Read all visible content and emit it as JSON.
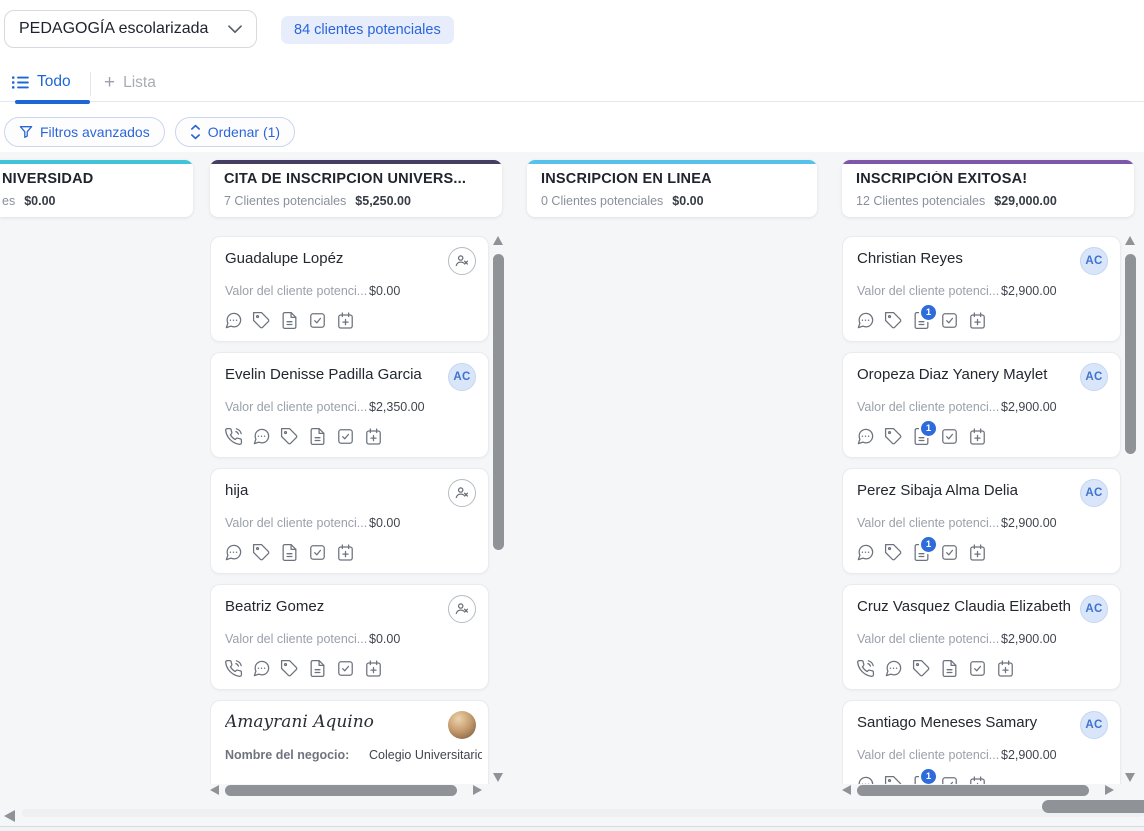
{
  "header": {
    "pipeline_selector": "PEDAGOGÍA escolarizada",
    "leads_count_badge": "84 clientes potenciales",
    "tabs": {
      "todo": "Todo",
      "lista_prefix": "+",
      "lista": "Lista"
    },
    "filters_button": "Filtros avanzados",
    "sort_button": "Ordenar (1)"
  },
  "colors": {
    "primary_blue": "#2b66d9",
    "notification_badge_blue": "#2e6bdb",
    "board_background": "#f5f6f7"
  },
  "board": {
    "columns": [
      {
        "title": "NIVERSIDAD",
        "count_text": "es",
        "value": "$0.00",
        "accent": "#41c4d5",
        "cards": []
      },
      {
        "title": "CITA DE INSCRIPCION UNIVERS...",
        "count_text": "7 Clientes potenciales",
        "value": "$5,250.00",
        "accent": "#454063",
        "cards": [
          {
            "name": "Guadalupe Lopéz",
            "field_label": "Valor del cliente potenci...",
            "field_value": "$0.00",
            "avatar": "unassigned",
            "icons": [
              "chat",
              "tag",
              "document",
              "task",
              "calendar"
            ]
          },
          {
            "name": "Evelin Denisse Padilla Garcia",
            "field_label": "Valor del cliente potenci...",
            "field_value": "$2,350.00",
            "avatar": "initials",
            "avatar_text": "AC",
            "icons": [
              "phone",
              "chat",
              "tag",
              "document",
              "task",
              "calendar"
            ]
          },
          {
            "name": "hija",
            "field_label": "Valor del cliente potenci...",
            "field_value": "$0.00",
            "avatar": "unassigned",
            "icons": [
              "chat",
              "tag",
              "document",
              "task",
              "calendar"
            ]
          },
          {
            "name": "Beatriz Gomez",
            "field_label": "Valor del cliente potenci...",
            "field_value": "$0.00",
            "avatar": "unassigned",
            "icons": [
              "phone",
              "chat",
              "tag",
              "document",
              "task",
              "calendar"
            ]
          },
          {
            "name": "Amayrani Aquino",
            "name_style": "script",
            "field_label": "Nombre del negocio:",
            "field_value": "Colegio Universitario Ka",
            "avatar": "photo",
            "icons": []
          }
        ]
      },
      {
        "title": "INSCRIPCION EN LINEA",
        "count_text": "0 Clientes potenciales",
        "value": "$0.00",
        "accent": "#57c2e9",
        "cards": []
      },
      {
        "title": "INSCRIPCIÓN EXITOSA!",
        "count_text": "12 Clientes potenciales",
        "value": "$29,000.00",
        "accent": "#7e57a9",
        "cards": [
          {
            "name": "Christian Reyes",
            "field_label": "Valor del cliente potenci...",
            "field_value": "$2,900.00",
            "avatar": "initials",
            "avatar_text": "AC",
            "icons": [
              "chat",
              "tag",
              {
                "name": "document",
                "badge": "1"
              },
              "task",
              "calendar"
            ]
          },
          {
            "name": "Oropeza Diaz Yanery Maylet",
            "field_label": "Valor del cliente potenci...",
            "field_value": "$2,900.00",
            "avatar": "initials",
            "avatar_text": "AC",
            "icons": [
              "chat",
              "tag",
              {
                "name": "document",
                "badge": "1"
              },
              "task",
              "calendar"
            ]
          },
          {
            "name": "Perez Sibaja Alma Delia",
            "field_label": "Valor del cliente potenci...",
            "field_value": "$2,900.00",
            "avatar": "initials",
            "avatar_text": "AC",
            "icons": [
              "chat",
              "tag",
              {
                "name": "document",
                "badge": "1"
              },
              "task",
              "calendar"
            ]
          },
          {
            "name": "Cruz Vasquez Claudia Elizabeth",
            "field_label": "Valor del cliente potenci...",
            "field_value": "$2,900.00",
            "avatar": "initials",
            "avatar_text": "AC",
            "icons": [
              "phone",
              "chat",
              "tag",
              "document",
              "task",
              "calendar"
            ]
          },
          {
            "name": "Santiago Meneses Samary",
            "field_label": "Valor del cliente potenci...",
            "field_value": "$2,900.00",
            "avatar": "initials",
            "avatar_text": "AC",
            "icons": [
              "chat",
              "tag",
              {
                "name": "document",
                "badge": "1"
              },
              "task",
              "calendar"
            ]
          }
        ]
      }
    ]
  }
}
